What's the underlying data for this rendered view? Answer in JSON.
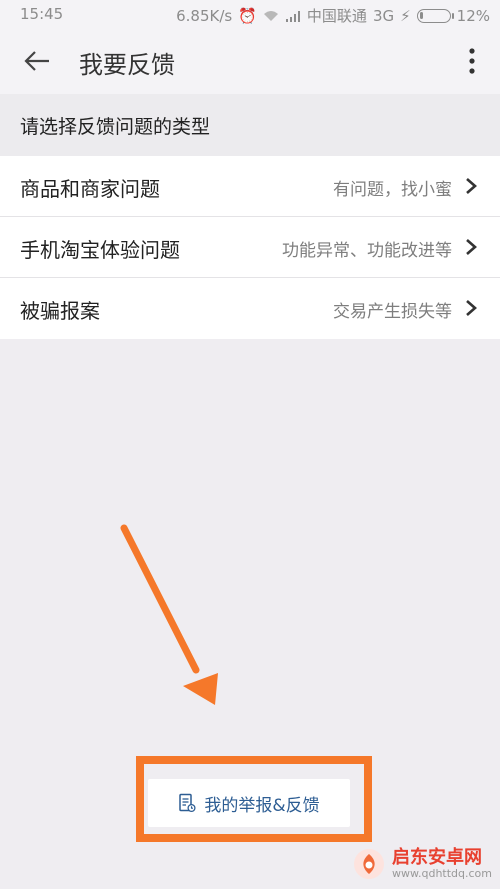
{
  "status_bar": {
    "time": "15:45",
    "speed": "6.85K/s",
    "carrier": "中国联通",
    "network": "3G",
    "battery": "12%",
    "battery_level": 0.12
  },
  "header": {
    "title": "我要反馈"
  },
  "section": {
    "title": "请选择反馈问题的类型"
  },
  "rows": [
    {
      "label": "商品和商家问题",
      "hint": "有问题，找小蜜"
    },
    {
      "label": "手机淘宝体验问题",
      "hint": "功能异常、功能改进等"
    },
    {
      "label": "被骗报案",
      "hint": "交易产生损失等"
    }
  ],
  "feedback_button": {
    "label": "我的举报&反馈"
  },
  "watermark": {
    "title": "启东安卓网",
    "url": "www.qdhttdq.com"
  },
  "colors": {
    "accent": "#f5782a",
    "link": "#2d5d93",
    "background": "#efedf1"
  }
}
